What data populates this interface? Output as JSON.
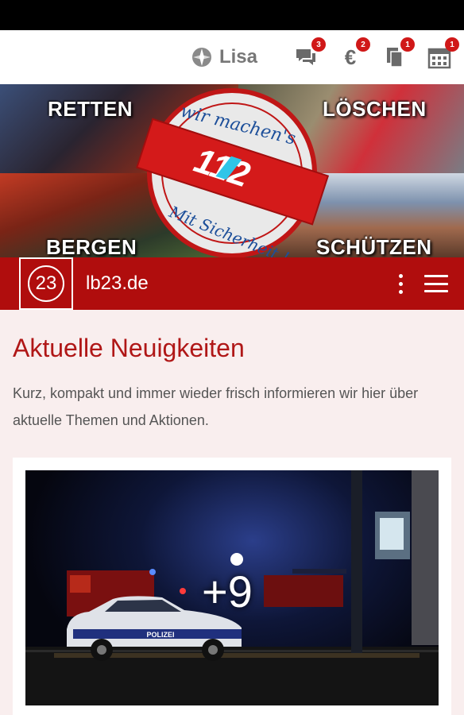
{
  "user": {
    "name": "Lisa",
    "logo_icon": "lb23-logo-icon"
  },
  "toolbar": {
    "messages": {
      "icon": "chat-icon",
      "badge": "3"
    },
    "payments": {
      "icon": "euro-icon",
      "badge": "2"
    },
    "documents": {
      "icon": "documents-icon",
      "badge": "1"
    },
    "calendar": {
      "icon": "calendar-icon",
      "badge": "1"
    }
  },
  "banner": {
    "tl": "RETTEN",
    "tr": "LÖSCHEN",
    "bl": "BERGEN",
    "br": "SCHÜTZEN",
    "seal_top": "wir machen's",
    "seal_bottom": "Mit Sicherheit !",
    "seal_number": "112"
  },
  "nav": {
    "logo_text": "23",
    "title": "lb23.de",
    "menu_icon": "more-vertical-icon",
    "hamburger_icon": "hamburger-icon"
  },
  "content": {
    "title": "Aktuelle Neuigkeiten",
    "lead": "Kurz, kompakt und immer wieder frisch informieren wir hier über aktuelle Themen und Aktionen."
  },
  "card": {
    "more_count": "+9",
    "police_label": "POLIZEI"
  },
  "colors": {
    "brand_red": "#b00d0d",
    "badge_red": "#d01818",
    "bg_tint": "#f9eeee"
  }
}
